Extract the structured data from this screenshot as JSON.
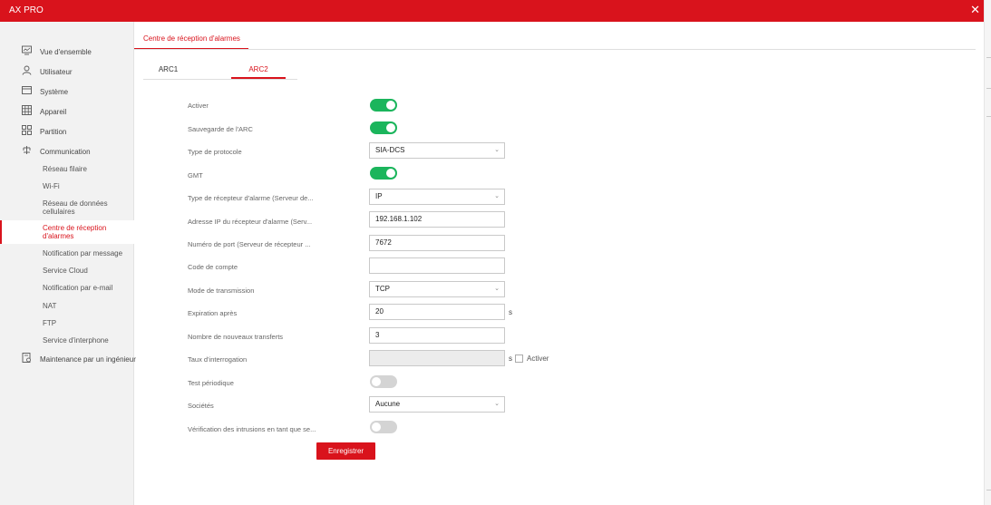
{
  "app": {
    "title": "AX PRO",
    "close_symbol": "✕"
  },
  "sidebar": {
    "items": [
      {
        "label": "Vue d'ensemble",
        "icon": "monitor-icon"
      },
      {
        "label": "Utilisateur",
        "icon": "user-icon"
      },
      {
        "label": "Système",
        "icon": "window-icon"
      },
      {
        "label": "Appareil",
        "icon": "device-grid-icon"
      },
      {
        "label": "Partition",
        "icon": "partition-icon"
      },
      {
        "label": "Communication",
        "icon": "network-icon"
      },
      {
        "label": "Maintenance par un ingénieur",
        "icon": "maintenance-icon"
      }
    ],
    "communication_subitems": [
      "Réseau filaire",
      "Wi-Fi",
      "Réseau de données cellulaires",
      "Centre de réception d'alarmes",
      "Notification par message",
      "Service Cloud",
      "Notification par e-mail",
      "NAT",
      "FTP",
      "Service d'interphone"
    ],
    "active_subitem": "Centre de réception d'alarmes"
  },
  "main": {
    "page_tab": "Centre de réception d'alarmes",
    "subtabs": [
      "ARC1",
      "ARC2"
    ],
    "active_subtab": "ARC2",
    "form": {
      "enable_label": "Activer",
      "enable_on": true,
      "arc_backup_label": "Sauvegarde de l'ARC",
      "arc_backup_on": true,
      "protocol_label": "Type de protocole",
      "protocol_value": "SIA-DCS",
      "gmt_label": "GMT",
      "gmt_on": true,
      "receiver_type_label": "Type de récepteur d'alarme  (Serveur de...",
      "receiver_type_value": "IP",
      "receiver_ip_label": "Adresse IP du récepteur d'alarme  (Serv...",
      "receiver_ip_value": "192.168.1.102",
      "port_label": "Numéro de port  (Serveur de récepteur ...",
      "port_value": "7672",
      "account_label": "Code de compte",
      "account_value": "",
      "transmission_label": "Mode de transmission",
      "transmission_value": "TCP",
      "expiration_label": "Expiration après",
      "expiration_value": "20",
      "expiration_unit": "s",
      "retries_label": "Nombre de nouveaux transferts",
      "retries_value": "3",
      "polling_label": "Taux d'interrogation",
      "polling_value": "",
      "polling_unit": "s",
      "polling_enable_label": "Activer",
      "polling_enable_checked": false,
      "periodic_test_label": "Test périodique",
      "periodic_test_on": false,
      "companies_label": "Sociétés",
      "companies_value": "Aucune",
      "intrusion_check_label": "Vérification des intrusions en tant que se...",
      "intrusion_check_on": false
    },
    "save_label": "Enregistrer"
  },
  "colors": {
    "brand_red": "#d9131c",
    "toggle_on": "#1bb55c",
    "toggle_off": "#d4d4d4",
    "sidebar_bg": "#f2f2f2"
  }
}
